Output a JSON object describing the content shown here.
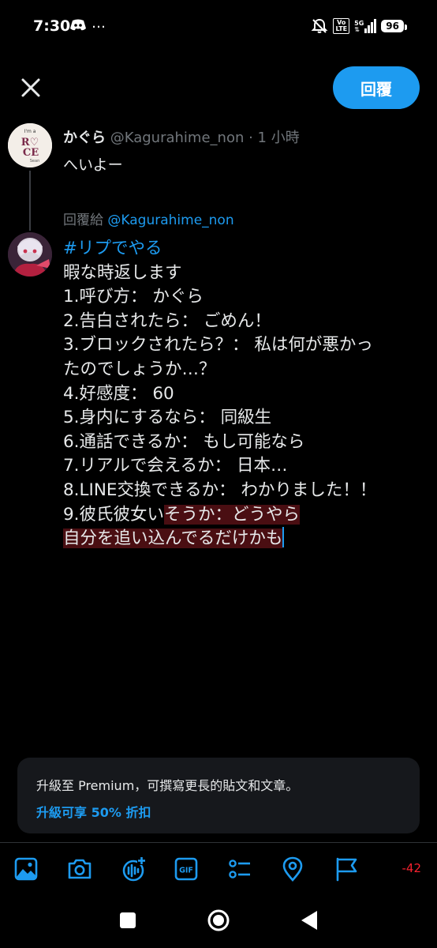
{
  "status_bar": {
    "time": "7:30",
    "dots": "…",
    "volte_top": "Vo",
    "volte_bottom": "LTE",
    "network": "5G",
    "battery": "96"
  },
  "header": {
    "reply_label": "回覆"
  },
  "original_tweet": {
    "name": "かぐら",
    "handle_time": "@Kagurahime_non · 1 小時",
    "text": "へいよー",
    "avatar_text_top": "I'm a",
    "avatar_text_main1": "R♡",
    "avatar_text_main2": "CE",
    "avatar_text_bottom": "Sean"
  },
  "replying_to": {
    "prefix": "回覆給 ",
    "handle": "@Kagurahime_non"
  },
  "compose": {
    "hashtag": "#リプでやる",
    "lines": [
      "暇な時返します",
      "1.呼び方： かぐら",
      "2.告白されたら： ごめん！",
      "3.ブロックされたら？： 私は何が悪かっ",
      "たのでしょうか…？",
      "4.好感度： 60",
      "5.身内にするなら： 同級生",
      "6.通話できるか： もし可能なら",
      "7.リアルで会えるか： 日本…",
      "8.LINE交換できるか： わかりました！！"
    ],
    "line9_normal": "9.彼氏彼女い",
    "line9_over": "そうか：どうやら",
    "line10_over": "自分を追い込んでるだけかも"
  },
  "premium": {
    "text": "升級至 Premium，可撰寫更長的貼文和文章。",
    "link": "升級可享 50% 折扣"
  },
  "toolbar": {
    "icons": [
      "image-icon",
      "camera-icon",
      "voice-icon",
      "gif-icon",
      "poll-icon",
      "location-icon",
      "flag-icon"
    ],
    "gif_label": "GIF",
    "counter": "-42",
    "accent": "#1d9bf0",
    "over_color": "#f4212e"
  }
}
